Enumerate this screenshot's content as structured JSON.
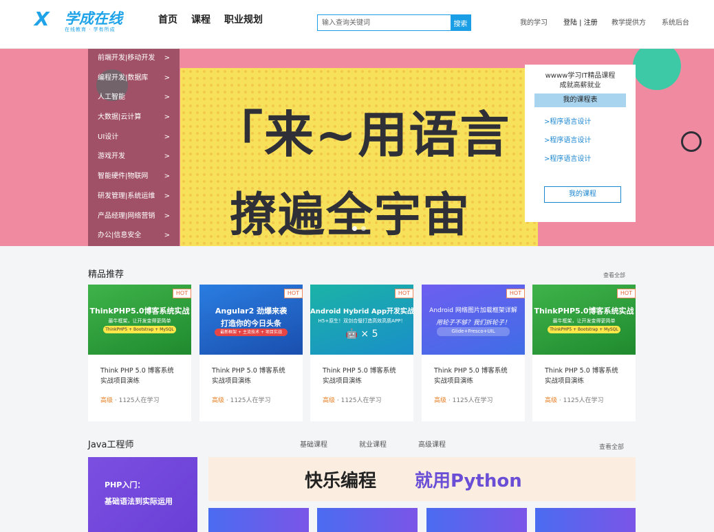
{
  "header": {
    "logo_mark": "X",
    "logo_text": "学成在线",
    "logo_slogan": "在线教育 · 学有所成",
    "nav": [
      "首页",
      "课程",
      "职业规划"
    ],
    "search_placeholder": "输入查询关键词",
    "search_button": "搜索",
    "links": {
      "my_study": "我的学习",
      "login": "登陆 | 注册",
      "teaching": "教学提供方",
      "admin": "系统后台"
    }
  },
  "banner": {
    "headline_1": "「来~用语言",
    "headline_2": "撩遍全宇宙",
    "categories": [
      "前端开发|移动开发",
      "编程开发|数据库",
      "人工智能",
      "大数据|云计算",
      "UI设计",
      "游戏开发",
      "智能硬件|物联网",
      "研发管理|系统运维",
      "产品经理|网络营销",
      "办公|信息安全"
    ],
    "arrow": ">",
    "side": {
      "welcome_1": "wwww学习IT精品课程",
      "welcome_2": "成就高薪就业",
      "my_table": "我的课程表",
      "links": [
        ">程序语言设计",
        ">程序语言设计",
        ">程序语言设计"
      ],
      "my_course_button": "我的课程"
    }
  },
  "featured": {
    "title": "精品推荐",
    "view_all": "查看全部",
    "hot_label": "HOT",
    "cards": [
      {
        "thumb_title": "ThinkPHP5.0博客系统实战",
        "thumb_sub": "最牛框架，让开发变得更简单",
        "thumb_pill": "ThinkPHP5 + Bootstrap + MySQL",
        "name": "Think PHP 5.0 博客系统实战项目演练",
        "level": "高级",
        "students": " · 1125人在学习",
        "bg": "#2f9e3a"
      },
      {
        "thumb_title": "Angular2 劲爆来袭",
        "thumb_sub": "打造你的今日头条",
        "thumb_pill": "最新框架 + 主流技术 + 项目实战",
        "name": "Think PHP 5.0 博客系统实战项目演练",
        "level": "高级",
        "students": " · 1125人在学习",
        "bg": "#1c63c9"
      },
      {
        "thumb_title": "Android Hybrid App开发实战",
        "thumb_sub": "H5+原生！双剑合璧打造高效高质APP！",
        "thumb_pill": "🤖 × 5",
        "name": "Think PHP 5.0 博客系统实战项目演练",
        "level": "高级",
        "students": " · 1125人在学习",
        "bg": "#1aa4b8"
      },
      {
        "thumb_title": "Android 网络图片加载框架详解",
        "thumb_sub": "用轮子不够？我们拆轮子！",
        "thumb_pill": "Glide+Fresco+UIL",
        "name": "Think PHP 5.0 博客系统实战项目演练",
        "level": "高级",
        "students": " · 1125人在学习",
        "bg": "#5b62e8"
      },
      {
        "thumb_title": "ThinkPHP5.0博客系统实战",
        "thumb_sub": "最牛框架，让开发变得更简单",
        "thumb_pill": "ThinkPHP5 + Bootstrap + MySQL",
        "name": "Think PHP 5.0 博客系统实战项目演练",
        "level": "高级",
        "students": " · 1125人在学习",
        "bg": "#2f9e3a"
      }
    ]
  },
  "java": {
    "title": "Java工程师",
    "tabs": [
      "基础课程",
      "就业课程",
      "高级课程"
    ],
    "view_all": "查看全部",
    "php_card_line1": "PHP入门：",
    "php_card_line2": "基础语法到实际运用",
    "py_banner_1": "快乐编程",
    "py_banner_2": "就用Python"
  },
  "colors": {
    "brand": "#1a9ee5",
    "banner_bg": "#ef8aa0",
    "hot": "#e2653a",
    "level": "#e67e22"
  }
}
